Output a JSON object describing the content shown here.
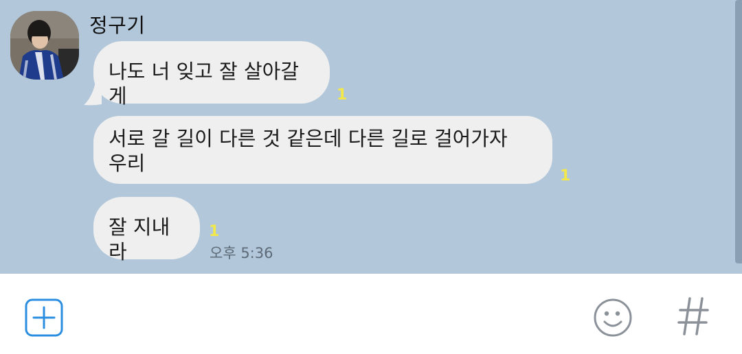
{
  "chat": {
    "sender_name": "정구기",
    "messages": [
      {
        "text": "나도 너 잊고 잘 살아갈게",
        "unread": "1"
      },
      {
        "text": "서로 갈 길이 다른 것 같은데 다른 길로 걸어가자",
        "text_line2": "우리",
        "unread": "1"
      },
      {
        "text": "잘 지내라",
        "unread": "1"
      }
    ],
    "last_time": "오후 5:36"
  },
  "input_bar": {
    "plus_icon": "plus-square-icon",
    "emoji_icon": "smiley-icon",
    "hash_icon": "hash-icon"
  },
  "colors": {
    "chat_background": "#b2c7da",
    "bubble": "#efefef",
    "unread_count": "#f2e84b",
    "accent_blue": "#2b8ee0"
  }
}
